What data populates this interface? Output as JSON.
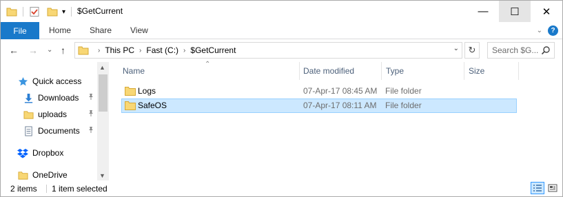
{
  "window": {
    "title": "$GetCurrent",
    "qa_dropdown": "▾",
    "minimize": "—",
    "maximize": "☐",
    "close": "✕"
  },
  "ribbon": {
    "tabs": [
      {
        "label": "File",
        "active": true
      },
      {
        "label": "Home"
      },
      {
        "label": "Share"
      },
      {
        "label": "View"
      }
    ],
    "expand": "⌄",
    "help": "?"
  },
  "navigation": {
    "back": "←",
    "forward": "→",
    "recent": "⌄",
    "up": "↑",
    "breadcrumb": [
      "This PC",
      "Fast (C:)",
      "$GetCurrent"
    ],
    "separator": "›",
    "address_dropdown": "⌄",
    "refresh": "↻",
    "search_placeholder": "Search $G..."
  },
  "sidebar": {
    "items": [
      {
        "label": "Quick access",
        "icon": "star-icon"
      },
      {
        "label": "Downloads",
        "icon": "download-icon",
        "pinned": true
      },
      {
        "label": "uploads",
        "icon": "folder-icon",
        "pinned": true
      },
      {
        "label": "Documents",
        "icon": "documents-icon",
        "pinned": true
      },
      {
        "label": "Dropbox",
        "icon": "dropbox-icon"
      },
      {
        "label": "OneDrive",
        "icon": "folder-icon"
      }
    ],
    "pin": "📌"
  },
  "file_list": {
    "columns": [
      "Name",
      "Date modified",
      "Type",
      "Size"
    ],
    "sort_indicator": "⌃",
    "rows": [
      {
        "name": "Logs",
        "date": "07-Apr-17 08:45 AM",
        "type": "File folder",
        "size": "",
        "selected": false
      },
      {
        "name": "SafeOS",
        "date": "07-Apr-17 08:11 AM",
        "type": "File folder",
        "size": "",
        "selected": true
      }
    ]
  },
  "status": {
    "item_count": "2 items",
    "selection": "1 item selected"
  },
  "colors": {
    "accent": "#1979ca",
    "selection_bg": "#cce8ff",
    "selection_border": "#99d1ff",
    "folder": "#f8d775"
  }
}
